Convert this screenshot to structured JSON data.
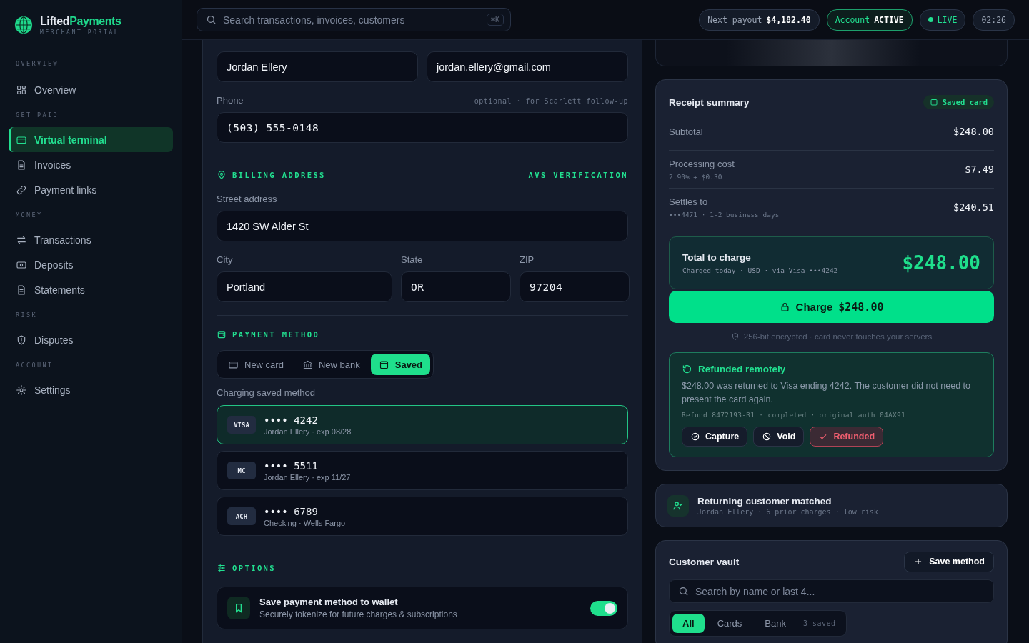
{
  "brand": {
    "name_first": "Lifted",
    "name_second": "Payments",
    "subtitle": "MERCHANT PORTAL"
  },
  "sidebar": {
    "sections": [
      {
        "label": "OVERVIEW",
        "items": [
          {
            "label": "Overview",
            "selected": false
          }
        ]
      },
      {
        "label": "GET PAID",
        "items": [
          {
            "label": "Virtual terminal",
            "selected": true
          },
          {
            "label": "Invoices",
            "selected": false
          },
          {
            "label": "Payment links",
            "selected": false
          }
        ]
      },
      {
        "label": "MONEY",
        "items": [
          {
            "label": "Transactions",
            "selected": false
          },
          {
            "label": "Deposits",
            "selected": false
          },
          {
            "label": "Statements",
            "selected": false
          }
        ]
      },
      {
        "label": "RISK",
        "items": [
          {
            "label": "Disputes",
            "selected": false
          }
        ]
      },
      {
        "label": "ACCOUNT",
        "items": [
          {
            "label": "Settings",
            "selected": false
          }
        ]
      }
    ]
  },
  "header": {
    "search_placeholder": "Search transactions, invoices, customers",
    "shortcut": "⌘K",
    "payout_label": "Next payout",
    "payout_value": "$4,182.40",
    "account_label": "Account",
    "account_value": "ACTIVE",
    "live_label": "LIVE",
    "live": true,
    "time": "02:26"
  },
  "customer": {
    "name_value": "Jordan Ellery",
    "email_value": "jordan.ellery@gmail.com",
    "phone_label": "Phone",
    "phone_hint": "optional · for Scarlett follow-up",
    "phone_value": "(503) 555-0148"
  },
  "billing": {
    "title": "BILLING ADDRESS",
    "badge": "AVS VERIFICATION",
    "street_label": "Street address",
    "street_value": "1420 SW Alder St",
    "city_label": "City",
    "city_value": "Portland",
    "state_label": "State",
    "state_value": "OR",
    "zip_label": "ZIP",
    "zip_value": "97204"
  },
  "payment": {
    "title": "PAYMENT METHOD",
    "tabs": [
      {
        "label": "New card",
        "selected": false
      },
      {
        "label": "New bank",
        "selected": false
      },
      {
        "label": "Saved",
        "selected": true
      }
    ],
    "note": "Charging saved method",
    "methods": [
      {
        "brand": "VISA",
        "number": "•••• 4242",
        "detail": "Jordan Ellery · exp 08/28",
        "selected": true
      },
      {
        "brand": "MC",
        "number": "•••• 5511",
        "detail": "Jordan Ellery · exp 11/27",
        "selected": false
      },
      {
        "brand": "ACH",
        "number": "•••• 6789",
        "detail": "Checking · Wells Fargo",
        "selected": false
      }
    ]
  },
  "options": {
    "title": "OPTIONS",
    "items": [
      {
        "title": "Save payment method to wallet",
        "description": "Securely tokenize for future charges & subscriptions",
        "on": true
      }
    ]
  },
  "receipt": {
    "title": "Receipt summary",
    "badge": "Saved card",
    "lines": [
      {
        "label": "Subtotal",
        "value": "$248.00"
      },
      {
        "label": "Processing cost",
        "sub": "2.90% + $0.30",
        "value": "$7.49"
      },
      {
        "label": "Settles to",
        "sub": "•••4471 · 1-2 business days",
        "value": "$240.51"
      }
    ],
    "total_label": "Total to charge",
    "total_sub": "Charged today · USD · via Visa •••4242",
    "total_amount": "$248.00",
    "charge_label": "Charge",
    "charge_amount": "$248.00",
    "security_note": "256-bit encrypted · card never touches your servers"
  },
  "refund": {
    "title": "Refunded remotely",
    "message": "$248.00 was returned to Visa ending 4242. The customer did not need to present the card again.",
    "meta": "Refund 8472193-R1 · completed · original auth 04AX91",
    "actions": [
      {
        "label": "Capture",
        "kind": "capture",
        "selected": false
      },
      {
        "label": "Void",
        "kind": "void",
        "selected": false
      },
      {
        "label": "Refunded",
        "kind": "refund",
        "selected": true
      }
    ]
  },
  "match": {
    "title": "Returning customer matched",
    "sub": "Jordan Ellery · 6 prior charges · low risk"
  },
  "vault": {
    "title": "Customer vault",
    "save_label": "Save method",
    "search_placeholder": "Search by name or last 4...",
    "filters": [
      {
        "label": "All",
        "selected": true
      },
      {
        "label": "Cards",
        "selected": false
      },
      {
        "label": "Bank",
        "selected": false
      }
    ],
    "count": "3 saved"
  }
}
